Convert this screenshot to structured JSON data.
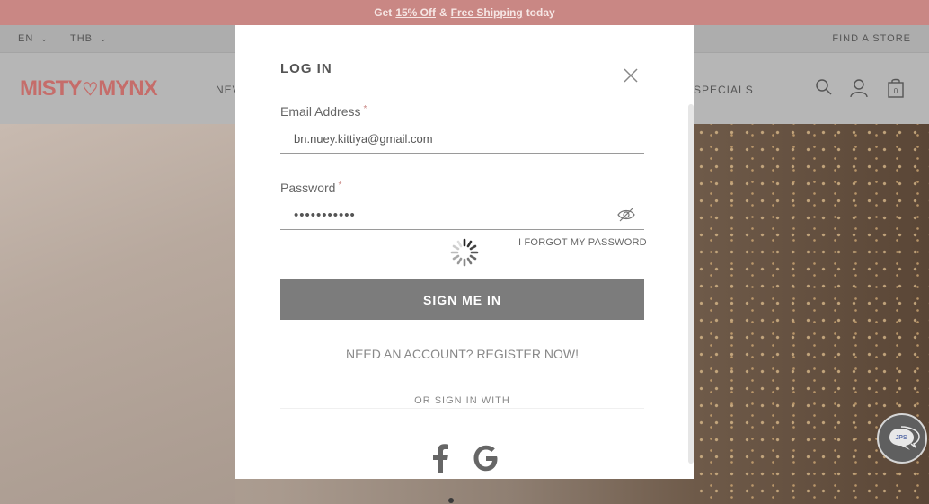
{
  "promo": {
    "prefix": "Get",
    "offer": "15% Off",
    "amp": "&",
    "shipping": "Free Shipping",
    "suffix": "today"
  },
  "utility": {
    "language": "EN",
    "currency": "THB",
    "find_store": "FIND A STORE"
  },
  "header": {
    "logo_left": "MISTY",
    "logo_heart": "♡",
    "logo_right": "MYNX",
    "nav_partial_left": "NEV",
    "nav_partial_right": "SPECIALS",
    "bag_count": "0"
  },
  "modal": {
    "title": "LOG IN",
    "email": {
      "label": "Email Address",
      "required_mark": "*",
      "value": "bn.nuey.kittiya@gmail.com"
    },
    "password": {
      "label": "Password",
      "required_mark": "*",
      "value": "•••••••••••"
    },
    "forgot": "I FORGOT MY PASSWORD",
    "sign_in": "SIGN ME IN",
    "register": "NEED AN ACCOUNT? REGISTER NOW!",
    "or_sign_in_with": "OR SIGN IN WITH"
  },
  "icons": {
    "close": "close-icon",
    "eye": "eye-slash-icon",
    "facebook": "facebook-icon",
    "google": "google-icon",
    "search": "search-icon",
    "account": "account-icon",
    "bag": "bag-icon",
    "chat": "chat-icon"
  },
  "chat_widget": {
    "label": "JPS"
  },
  "colors": {
    "promo": "#c98784",
    "logo": "#c56d6a",
    "button": "#7c7c7c"
  }
}
